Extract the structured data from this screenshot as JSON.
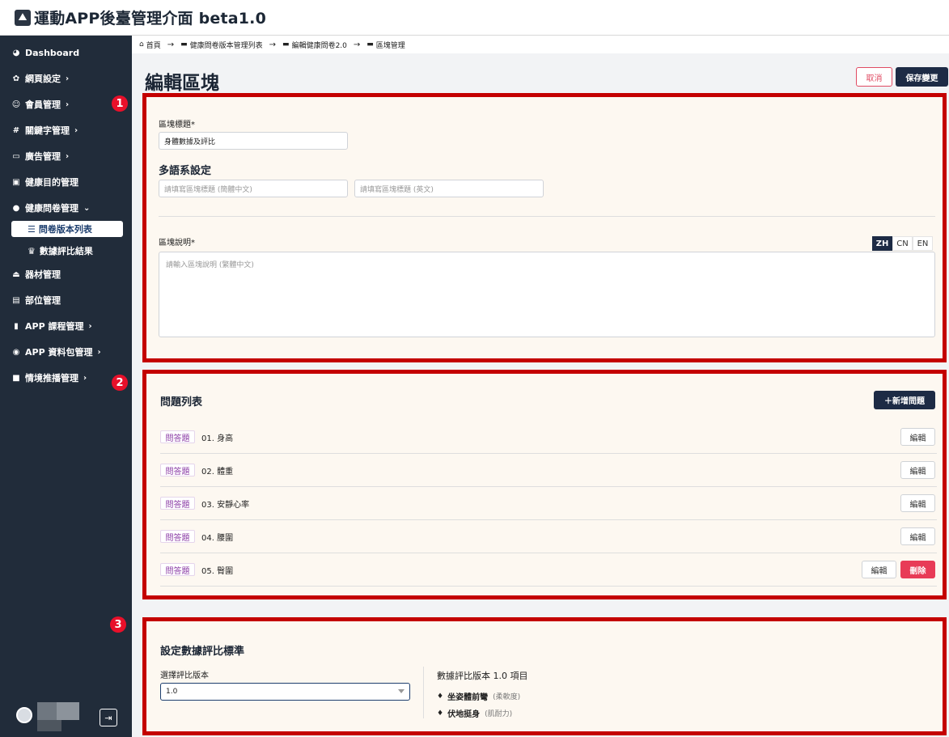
{
  "app": {
    "title": "運動APP後臺管理介面 beta1.0"
  },
  "sidebar": {
    "items": [
      {
        "label": "Dashboard",
        "icon": "dashboard-icon",
        "glyph": "◕",
        "chevron": ""
      },
      {
        "label": "網頁設定",
        "icon": "gear-icon",
        "glyph": "✿",
        "chevron": "›"
      },
      {
        "label": "會員管理",
        "icon": "users-icon",
        "glyph": "☺",
        "chevron": "›"
      },
      {
        "label": "關鍵字管理",
        "icon": "hashtag-icon",
        "glyph": "#",
        "chevron": "›"
      },
      {
        "label": "廣告管理",
        "icon": "ad-icon",
        "glyph": "▭",
        "chevron": "›"
      },
      {
        "label": "健康目的管理",
        "icon": "briefcase-icon",
        "glyph": "▣",
        "chevron": ""
      },
      {
        "label": "健康問卷管理",
        "icon": "comment-icon",
        "glyph": "●",
        "chevron": "⌄"
      },
      {
        "label": "器材管理",
        "icon": "equipment-icon",
        "glyph": "⏏",
        "chevron": ""
      },
      {
        "label": "部位管理",
        "icon": "body-icon",
        "glyph": "▤",
        "chevron": ""
      },
      {
        "label": "APP 課程管理",
        "icon": "book-icon",
        "glyph": "▮",
        "chevron": "›"
      },
      {
        "label": "APP 資料包管理",
        "icon": "database-icon",
        "glyph": "◉",
        "chevron": "›"
      },
      {
        "label": "情境推播管理",
        "icon": "message-icon",
        "glyph": "■",
        "chevron": "›"
      }
    ],
    "sub_active": {
      "label": "問卷版本列表",
      "icon": "list-icon",
      "glyph": "☰"
    },
    "sub_item": {
      "label": "數據評比結果",
      "icon": "crown-icon",
      "glyph": "♛"
    }
  },
  "annotations": [
    "1",
    "2",
    "3"
  ],
  "breadcrumb": [
    {
      "label": "首頁",
      "glyph": "⌂"
    },
    {
      "label": "健康問卷版本管理列表",
      "glyph": "▬"
    },
    {
      "label": "編輯健康問卷2.0",
      "glyph": "▬"
    },
    {
      "label": "區塊管理",
      "glyph": "▬"
    }
  ],
  "breadcrumb_arrow": "→",
  "header": {
    "title": "編輯區塊",
    "cancel_label": "取消",
    "save_label": "保存變更"
  },
  "block": {
    "title_label": "區塊標題*",
    "title_value": "身體數據及評比",
    "multilang_heading": "多語系設定",
    "placeholder_cn": "請填寫區塊標題 (簡體中文)",
    "placeholder_en": "請填寫區塊標題 (英文)",
    "desc_label": "區塊說明*",
    "lang_tabs": [
      "ZH",
      "CN",
      "EN"
    ],
    "desc_placeholder": "請輸入區塊說明 (繁體中文)"
  },
  "questions": {
    "heading": "問題列表",
    "add_label": "＋新增問題",
    "edit_label": "編輯",
    "delete_label": "刪除",
    "rows": [
      {
        "tag": "問答題",
        "text": "01. 身高"
      },
      {
        "tag": "問答題",
        "text": "02. 體重"
      },
      {
        "tag": "問答題",
        "text": "03. 安靜心率"
      },
      {
        "tag": "問答題",
        "text": "04. 腰圍"
      },
      {
        "tag": "問答題",
        "text": "05. 臀圍"
      }
    ]
  },
  "standard": {
    "heading": "設定數據評比標準",
    "select_label": "選擇評比版本",
    "select_value": "1.0",
    "items_heading": "數據評比版本 1.0 項目",
    "items": [
      {
        "name": "坐姿體前彎",
        "desc": "(柔軟度)",
        "glyph": "♦"
      },
      {
        "name": "伏地挺身",
        "desc": "(肌耐力)",
        "glyph": "♦"
      }
    ]
  },
  "colors": {
    "sidebar_bg": "#212c3a",
    "primary": "#1d2b45",
    "danger": "#e83b57",
    "highlight_border": "#c40000",
    "tag_text": "#8a3aa5"
  }
}
